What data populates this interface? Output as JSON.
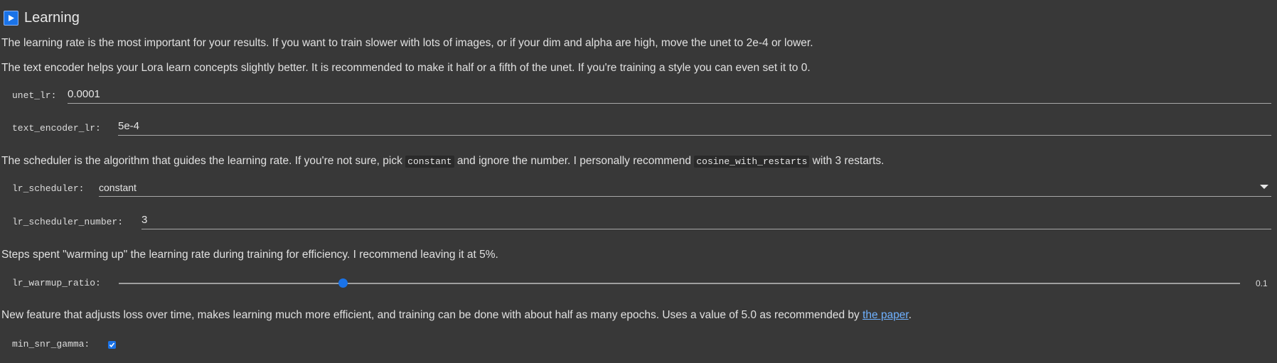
{
  "section": {
    "title": "Learning",
    "icon": "play-icon"
  },
  "paragraphs": {
    "lr_intro": "The learning rate is the most important for your results. If you want to train slower with lots of images, or if your dim and alpha are high, move the unet to 2e-4 or lower.",
    "te_intro": "The text encoder helps your Lora learn concepts slightly better. It is recommended to make it half or a fifth of the unet. If you're training a style you can even set it to 0.",
    "scheduler": {
      "part1": "The scheduler is the algorithm that guides the learning rate. If you're not sure, pick ",
      "code1": "constant",
      "part2": " and ignore the number. I personally recommend ",
      "code2": "cosine_with_restarts",
      "part3": " with 3 restarts."
    },
    "warmup": "Steps spent \"warming up\" the learning rate during training for efficiency. I recommend leaving it at 5%.",
    "snr": {
      "part1": "New feature that adjusts loss over time, makes learning much more efficient, and training can be done with about half as many epochs. Uses a value of 5.0 as recommended by ",
      "link": "the paper",
      "part2": "."
    }
  },
  "params": {
    "unet_lr": {
      "label": "unet_lr:",
      "value": "0.0001"
    },
    "text_encoder_lr": {
      "label": "text_encoder_lr:",
      "value": "5e-4"
    },
    "lr_scheduler": {
      "label": "lr_scheduler:",
      "value": "constant",
      "icon": "dropdown-arrow-icon"
    },
    "lr_scheduler_number": {
      "label": "lr_scheduler_number:",
      "value": "3"
    },
    "lr_warmup_ratio": {
      "label": "lr_warmup_ratio:",
      "value": "0.1",
      "min": 0,
      "max": 0.5,
      "position": 0.2
    },
    "min_snr_gamma": {
      "label": "min_snr_gamma:",
      "checked": true
    }
  },
  "colors": {
    "background": "#383838",
    "accent": "#1a73e8",
    "link": "#6fb1ff"
  }
}
